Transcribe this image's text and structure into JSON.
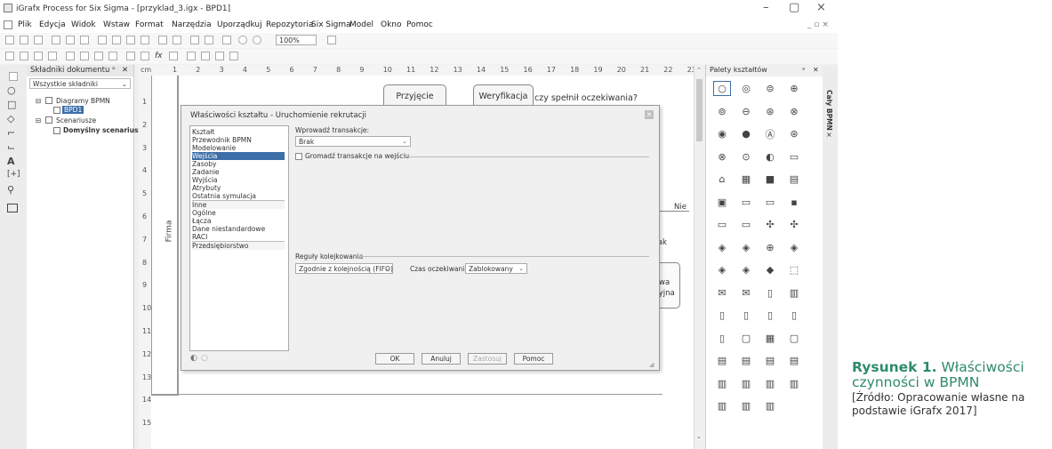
{
  "window": {
    "title": "iGrafx Process for Six Sigma - [przyklad_3.igx - BPD1]",
    "controls": [
      "–",
      "▢",
      "×"
    ]
  },
  "menu": [
    "Plik",
    "Edycja",
    "Widok",
    "Wstaw",
    "Format",
    "Narzędzia",
    "Uporządkuj",
    "Repozytoria",
    "Six Sigma",
    "Model",
    "Okno",
    "Pomoc"
  ],
  "toolbar": {
    "zoom": "100%",
    "fx": "fx"
  },
  "left_panel": {
    "title": "Składniki dokumentu",
    "pin": "ᵃ",
    "close": "✕",
    "filter": "Wszystkie składniki",
    "tree": [
      "Diagramy BPMN",
      "BPD1",
      "Scenariusze",
      "Domyślny scenariusz"
    ]
  },
  "ruler": {
    "unit": "cm",
    "top": [
      "1",
      "2",
      "3",
      "4",
      "5",
      "6",
      "7",
      "8",
      "9",
      "10",
      "11",
      "12",
      "13",
      "14",
      "15",
      "16",
      "17",
      "18",
      "19",
      "20",
      "21",
      "22",
      "23"
    ],
    "left": [
      "1",
      "2",
      "3",
      "4",
      "5",
      "6",
      "7",
      "8",
      "9",
      "10",
      "11",
      "12",
      "13",
      "14",
      "15"
    ]
  },
  "diagram": {
    "pool": "Firma",
    "przyjecie": "Przyjęcie",
    "weryfikacja": "Weryfikacja",
    "question": "czy spełnił oczekiwania?",
    "nie": "Nie",
    "tak": "Tak",
    "partial1": "wa",
    "partial2": "cyjna"
  },
  "dialog": {
    "title": "Właściwości kształtu - Uruchomienie rekrutacji",
    "close": "×",
    "nav": [
      "Kształt",
      "Przewodnik BPMN",
      "Modelowanie",
      "Wejścia",
      "Zasoby",
      "Zadanie",
      "Wyjścia",
      "Atrybuty",
      "Ostatnia symulacja",
      "Inne",
      "Ogólne",
      "Łącza",
      "Dane niestandardowe",
      "RACI",
      "Przedsiębiorstwo"
    ],
    "selected_nav": "Wejścia",
    "input_tx_label": "Wprowadź transakcje:",
    "input_tx_value": "Brak",
    "gather_label": "Gromadź transakcje na wejściu",
    "queue_label": "Reguły kolejkowania",
    "queue_value": "Zgodnie z kolejnością (FIFO)",
    "wait_label": "Czas oczekiwania:",
    "wait_value": "Zablokowany",
    "buttons": {
      "ok": "OK",
      "cancel": "Anuluj",
      "apply": "Zastosuj",
      "help": "Pomoc"
    }
  },
  "palette": {
    "title": "Palety kształtów",
    "pin": "ᵃ",
    "close": "✕",
    "side_tab": "Cały BPMN"
  },
  "caption": {
    "label": "Rysunek 1.",
    "title": "Właściwości czynności w BPMN",
    "source": "[Źródło: Opracowanie własne na podstawie iGrafx 2017]"
  }
}
